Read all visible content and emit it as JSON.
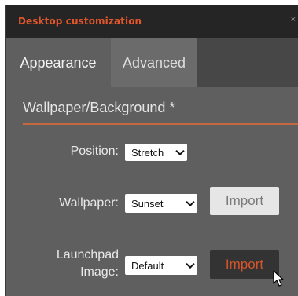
{
  "window": {
    "title": "Desktop customization",
    "close_glyph": "×"
  },
  "tabs": [
    {
      "label": "Appearance",
      "active": true
    },
    {
      "label": "Advanced",
      "active": false
    }
  ],
  "section": {
    "title": "Wallpaper/Background *"
  },
  "fields": {
    "position": {
      "label": "Position:",
      "value": "Stretch"
    },
    "wallpaper": {
      "label": "Wallpaper:",
      "value": "Sunset",
      "import_label": "Import"
    },
    "launchpad": {
      "label_line1": "Launchpad",
      "label_line2": "Image:",
      "value": "Default",
      "import_label": "Import"
    }
  },
  "colors": {
    "accent": "#e2562b",
    "panel": "#5f5f5f",
    "titlebar": "#252525"
  },
  "icons": {
    "close": "close-icon",
    "dropdown": "chevron-down-icon",
    "cursor": "mouse-cursor-icon"
  }
}
